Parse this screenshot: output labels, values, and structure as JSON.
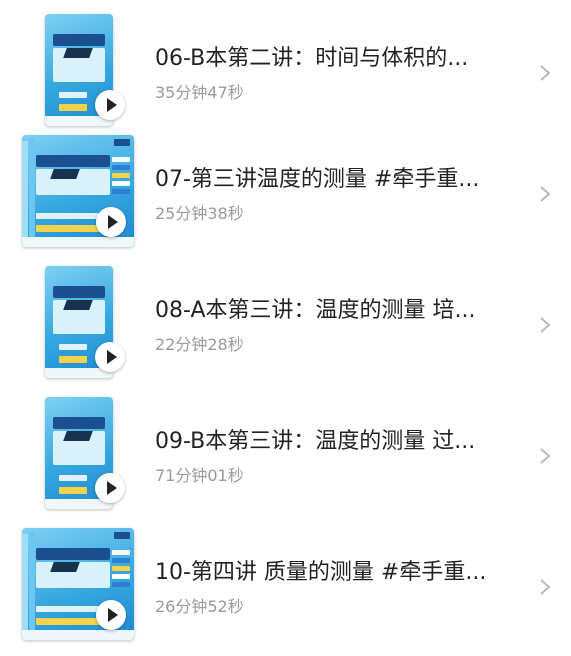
{
  "items": [
    {
      "title": "06-B本第二讲：时间与体积的...",
      "duration": "35分钟47秒",
      "thumb": "narrow"
    },
    {
      "title": "07-第三讲温度的测量 #牵手重...",
      "duration": "25分钟38秒",
      "thumb": "wide"
    },
    {
      "title": "08-A本第三讲：温度的测量 培...",
      "duration": "22分钟28秒",
      "thumb": "narrow"
    },
    {
      "title": "09-B本第三讲：温度的测量 过...",
      "duration": "71分钟01秒",
      "thumb": "narrow"
    },
    {
      "title": "10-第四讲 质量的测量 #牵手重...",
      "duration": "26分钟52秒",
      "thumb": "wide"
    }
  ],
  "icons": {
    "play": "play-icon",
    "chevron": "chevron-right-icon"
  },
  "colors": {
    "title": "#222222",
    "duration": "#9a9a9a",
    "cover": "#35a8e0",
    "chevron": "#b8b8b8"
  }
}
